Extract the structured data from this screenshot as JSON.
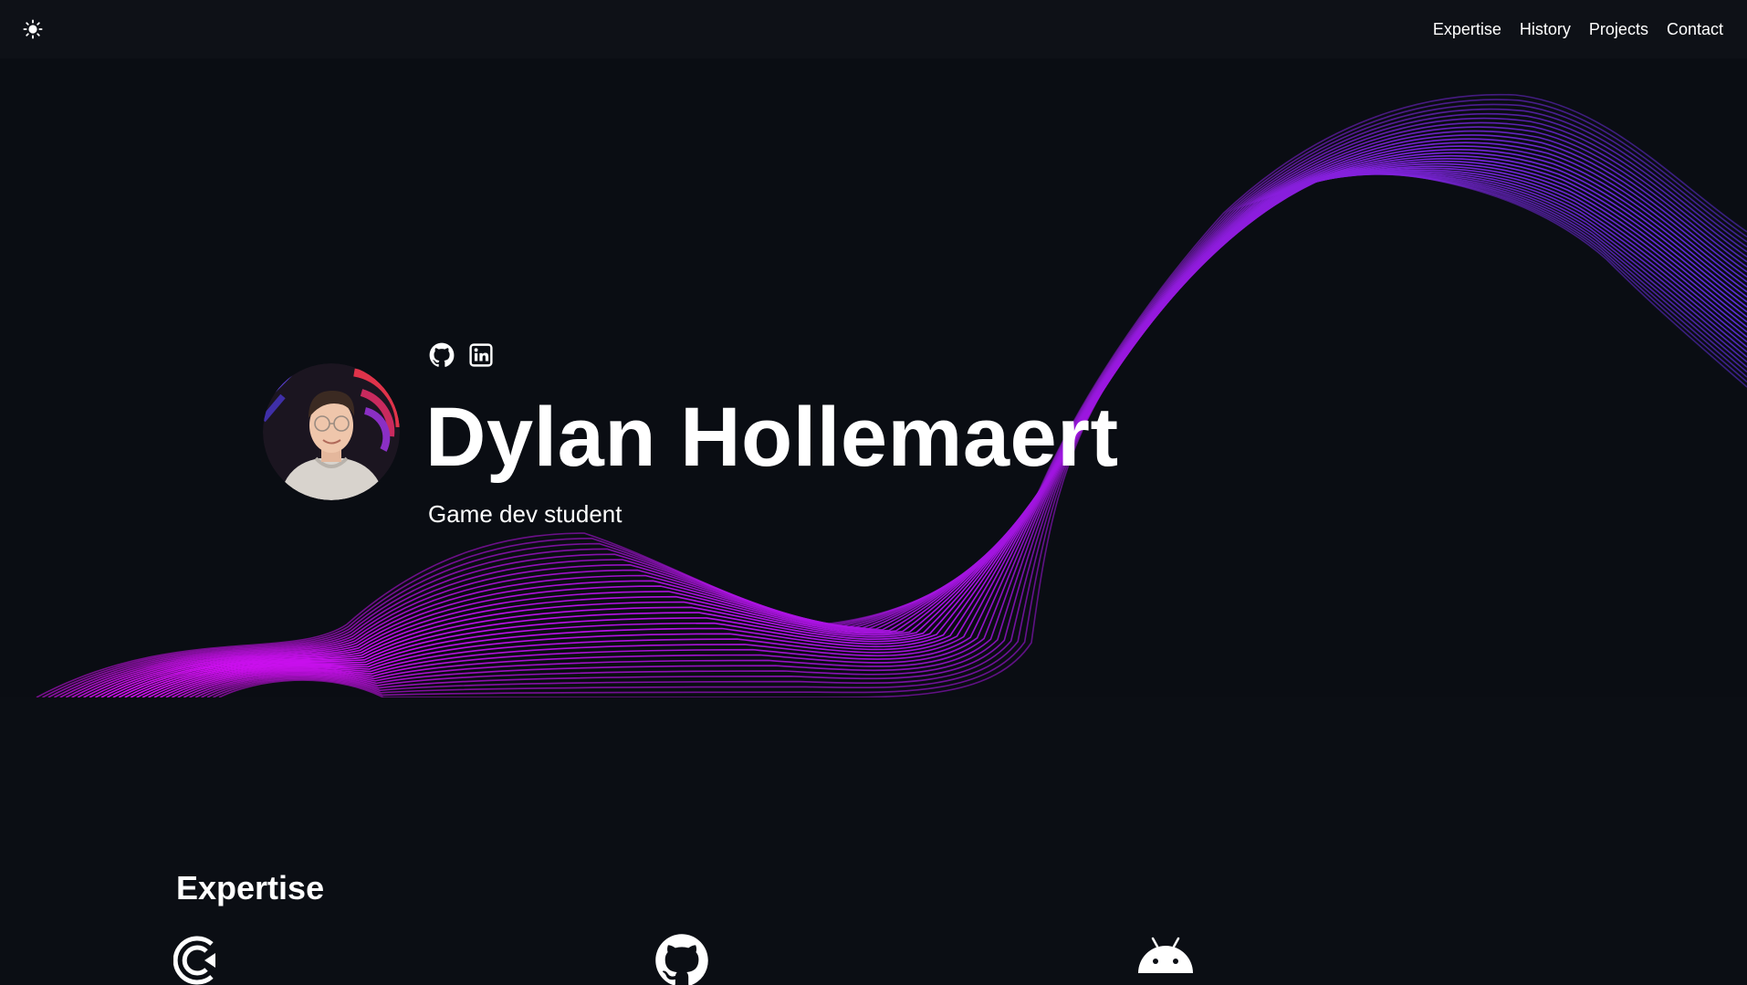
{
  "nav": {
    "theme_toggle_icon": "sun-icon",
    "links": [
      "Expertise",
      "History",
      "Projects",
      "Contact"
    ]
  },
  "hero": {
    "name": "Dylan Hollemaert",
    "subtitle": "Game dev student",
    "social_icons": [
      "github-icon",
      "linkedin-icon"
    ],
    "wave_colors": {
      "start": "#d10ef0",
      "end": "#5b2fd6"
    }
  },
  "expertise": {
    "title": "Expertise",
    "icons": [
      "unity-icon",
      "github-icon",
      "android-icon"
    ]
  },
  "colors": {
    "background": "#0b0e14",
    "navbar": "#0e1117",
    "text": "#ffffff"
  }
}
